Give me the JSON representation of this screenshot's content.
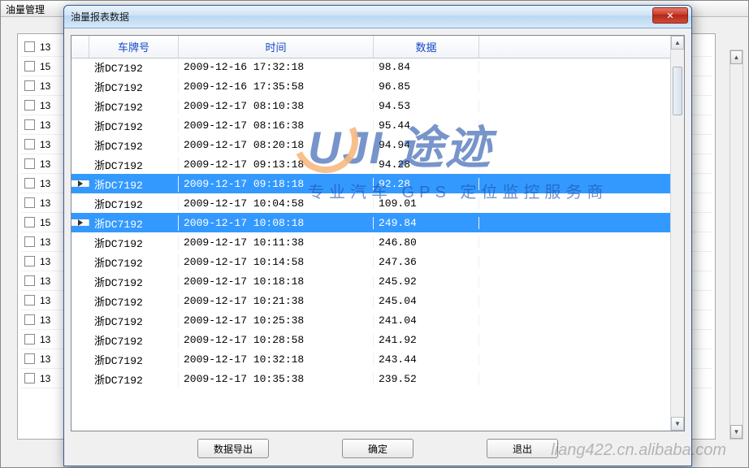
{
  "outer_window": {
    "title": "油量管理"
  },
  "bg_list_value": "13",
  "bg_list_alt_value": "15",
  "dialog": {
    "title": "油量报表数据",
    "close_glyph": "✕",
    "columns": {
      "plate": "车牌号",
      "time": "时间",
      "data": "数据"
    },
    "rows": [
      {
        "plate": "浙DC7192",
        "time": "2009-12-16 17:32:18",
        "data": "98.84",
        "selected": false
      },
      {
        "plate": "浙DC7192",
        "time": "2009-12-16 17:35:58",
        "data": "96.85",
        "selected": false
      },
      {
        "plate": "浙DC7192",
        "time": "2009-12-17 08:10:38",
        "data": "94.53",
        "selected": false
      },
      {
        "plate": "浙DC7192",
        "time": "2009-12-17 08:16:38",
        "data": "95.44",
        "selected": false
      },
      {
        "plate": "浙DC7192",
        "time": "2009-12-17 08:20:18",
        "data": "94.94",
        "selected": false
      },
      {
        "plate": "浙DC7192",
        "time": "2009-12-17 09:13:18",
        "data": "94.28",
        "selected": false
      },
      {
        "plate": "浙DC7192",
        "time": "2009-12-17 09:18:18",
        "data": "92.28",
        "selected": true
      },
      {
        "plate": "浙DC7192",
        "time": "2009-12-17 10:04:58",
        "data": "109.01",
        "selected": false
      },
      {
        "plate": "浙DC7192",
        "time": "2009-12-17 10:08:18",
        "data": "249.84",
        "selected": true
      },
      {
        "plate": "浙DC7192",
        "time": "2009-12-17 10:11:38",
        "data": "246.80",
        "selected": false
      },
      {
        "plate": "浙DC7192",
        "time": "2009-12-17 10:14:58",
        "data": "247.36",
        "selected": false
      },
      {
        "plate": "浙DC7192",
        "time": "2009-12-17 10:18:18",
        "data": "245.92",
        "selected": false
      },
      {
        "plate": "浙DC7192",
        "time": "2009-12-17 10:21:38",
        "data": "245.04",
        "selected": false
      },
      {
        "plate": "浙DC7192",
        "time": "2009-12-17 10:25:38",
        "data": "241.04",
        "selected": false
      },
      {
        "plate": "浙DC7192",
        "time": "2009-12-17 10:28:58",
        "data": "241.92",
        "selected": false
      },
      {
        "plate": "浙DC7192",
        "time": "2009-12-17 10:32:18",
        "data": "243.44",
        "selected": false
      },
      {
        "plate": "浙DC7192",
        "time": "2009-12-17 10:35:38",
        "data": "239.52",
        "selected": false
      }
    ],
    "buttons": {
      "export": "数据导出",
      "ok": "确定",
      "exit": "退出"
    }
  },
  "watermark": {
    "brand_left": "UJI",
    "brand_right": "途迹",
    "tagline": "专业汽车 GPS 定位监控服务商",
    "footer": "liang422.cn.alibaba.com"
  }
}
